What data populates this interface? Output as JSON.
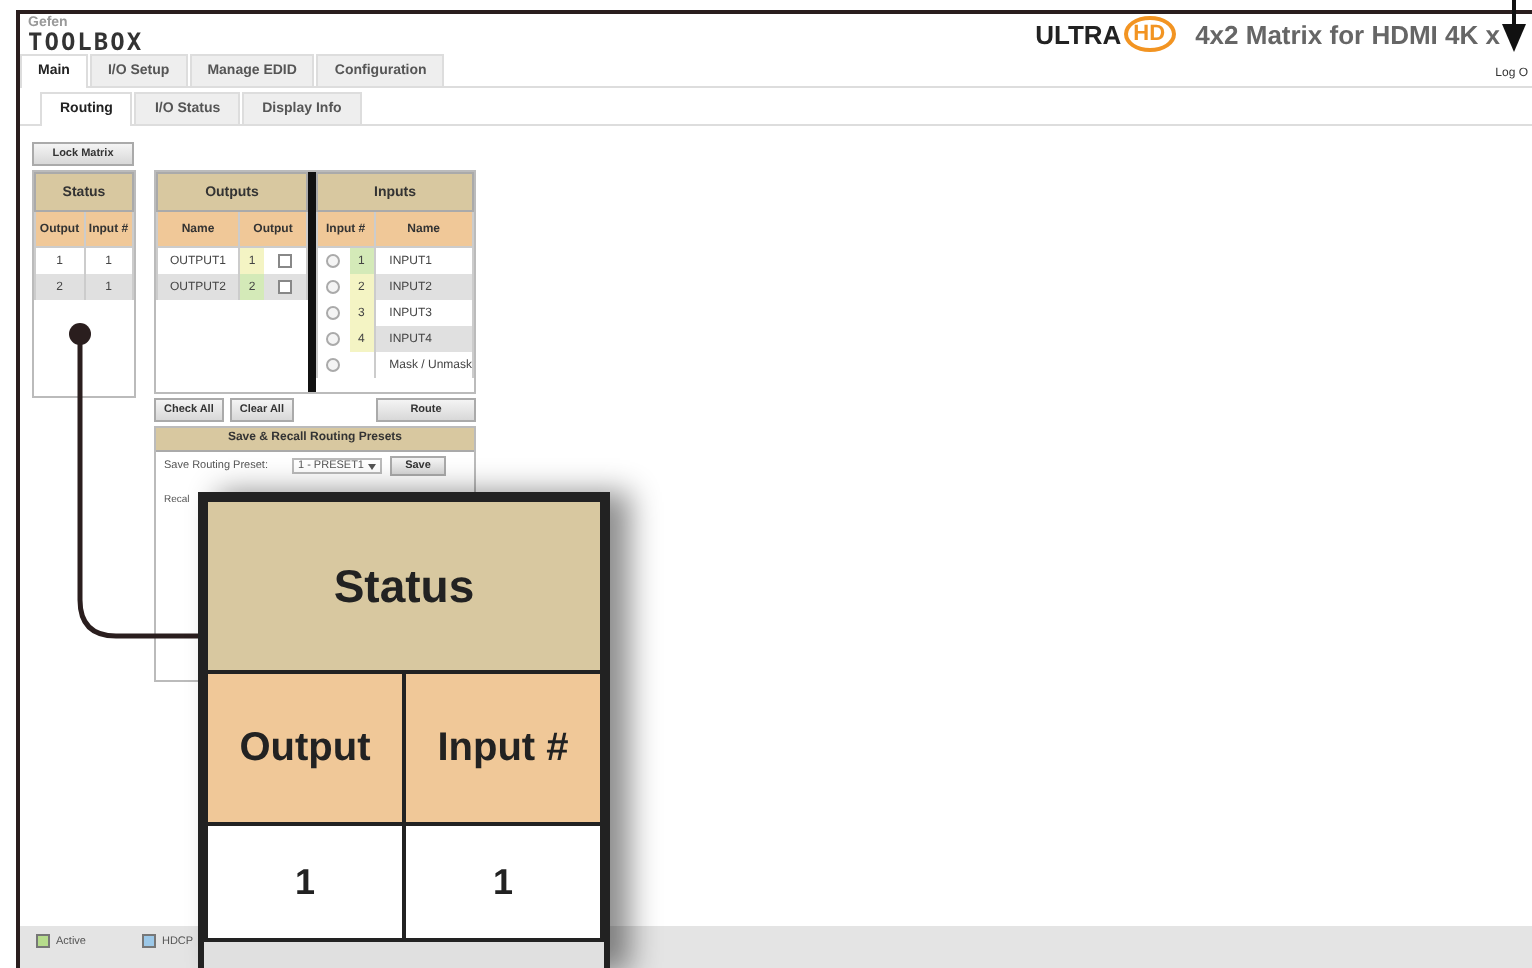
{
  "header": {
    "brand_small": "Gefen",
    "brand": "TOOLBOX",
    "badge_ultra": "ULTRA",
    "badge_hd": "HD",
    "title": "4x2 Matrix for HDMI 4K x",
    "logout": "Log O"
  },
  "tabs": [
    {
      "label": "Main",
      "selected": true
    },
    {
      "label": "I/O Setup",
      "selected": false
    },
    {
      "label": "Manage EDID",
      "selected": false
    },
    {
      "label": "Configuration",
      "selected": false
    }
  ],
  "subtabs": [
    {
      "label": "Routing",
      "selected": true
    },
    {
      "label": "I/O Status",
      "selected": false
    },
    {
      "label": "Display Info",
      "selected": false
    }
  ],
  "lock_button": "Lock Matrix",
  "status_table": {
    "title": "Status",
    "columns": [
      "Output",
      "Input #"
    ],
    "rows": [
      [
        "1",
        "1"
      ],
      [
        "2",
        "1"
      ]
    ]
  },
  "routing": {
    "outputs_title": "Outputs",
    "inputs_title": "Inputs",
    "output_columns": [
      "Name",
      "Output"
    ],
    "input_columns": [
      "Input #",
      "Name"
    ],
    "outputs": [
      {
        "name": "OUTPUT1",
        "input": "1",
        "color": "#f4f4c4",
        "checked": false
      },
      {
        "name": "OUTPUT2",
        "input": "2",
        "color": "#d4eab8",
        "checked": false
      }
    ],
    "inputs": [
      {
        "number": "1",
        "name": "INPUT1",
        "color": "#d4eab8",
        "selected": false
      },
      {
        "number": "2",
        "name": "INPUT2",
        "color": "#f4f4c4",
        "selected": false
      },
      {
        "number": "3",
        "name": "INPUT3",
        "color": "#f4f4c4",
        "selected": false
      },
      {
        "number": "4",
        "name": "INPUT4",
        "color": "#f4f4c4",
        "selected": false
      },
      {
        "name": "Mask / Unmask",
        "selected": false
      }
    ],
    "buttons": [
      "Check All",
      "Clear All"
    ],
    "route_button": "Route"
  },
  "presets": {
    "title": "Save & Recall Routing Presets",
    "save_label": "Save Routing Preset:",
    "save_select": "1 - PRESET1",
    "save_button": "Save",
    "recall_label": "Recal"
  },
  "legend": [
    {
      "label": "Active",
      "color": "#b6dc8c"
    },
    {
      "label": "HDCP",
      "color": "#9cc8e8"
    }
  ],
  "callout": {
    "title": "Status",
    "columns": [
      "Output",
      "Input #"
    ],
    "rows": [
      [
        "1",
        "1"
      ]
    ]
  }
}
